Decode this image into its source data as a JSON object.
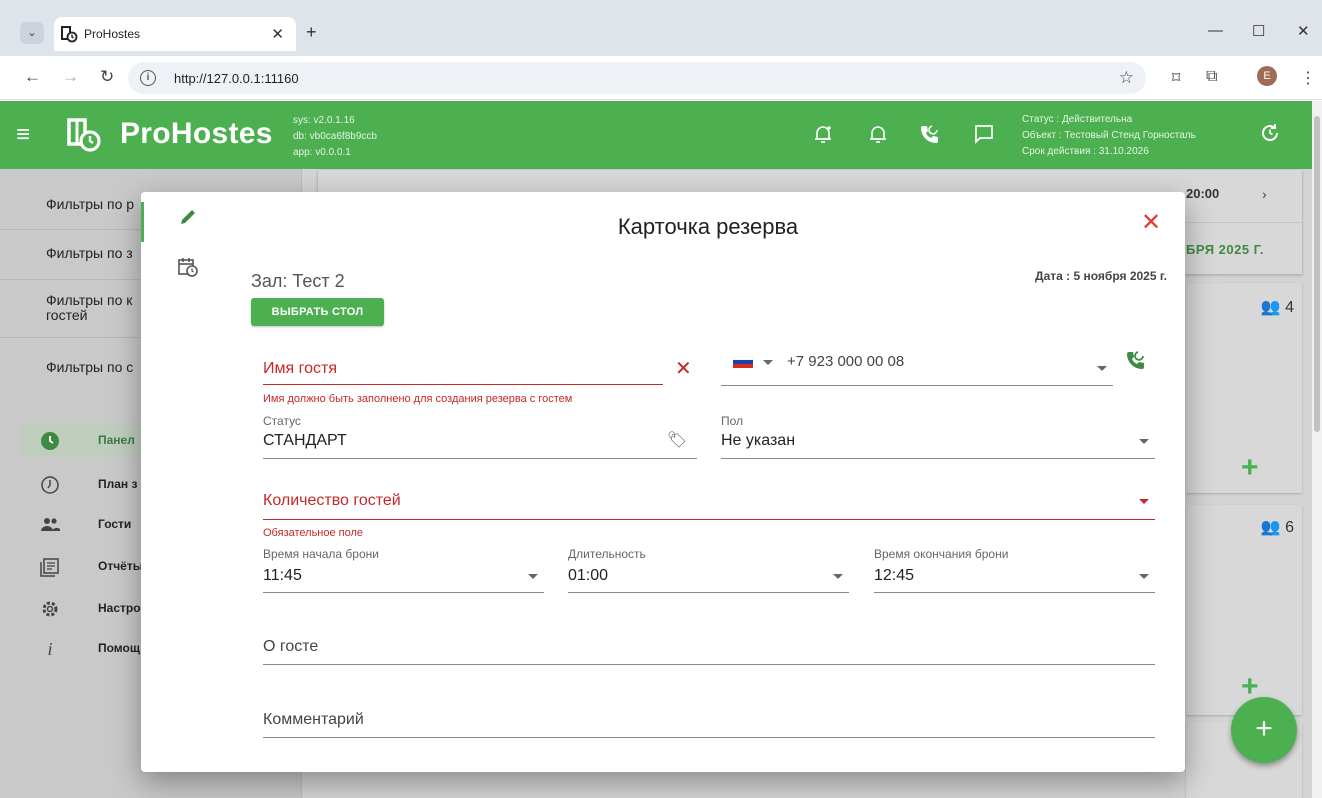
{
  "browser": {
    "tab_title": "ProHostes",
    "tab_close": "✕",
    "new_tab": "+",
    "url": "http://127.0.0.1:11160",
    "profile_initial": "E",
    "window_controls": {
      "minimize": "—",
      "maximize": "☐",
      "close": "✕"
    }
  },
  "app": {
    "name": "ProHostes",
    "versions": [
      "sys: v2.0.1.16",
      "db: vb0ca6f8b9ccb",
      "app: v0.0.0.1"
    ],
    "status_lines": [
      "Статус : Действительна",
      "Объект : Тестовый Стенд Горносталь",
      "Срок действия : 31.10.2026"
    ],
    "accent": "#4caf50",
    "error_color": "#c62828"
  },
  "sidebar": {
    "filters": [
      "Фильтры по р",
      "Фильтры по з",
      "Фильтры по к гостей",
      "Фильтры по с"
    ],
    "filter_lines_3": [
      "Фильтры по к",
      "гостей"
    ],
    "nav": [
      {
        "label": "Панел",
        "icon": "clock-filled-icon",
        "active": true
      },
      {
        "label": "План з",
        "icon": "clock-outline-icon"
      },
      {
        "label": "Гости",
        "icon": "people-icon"
      },
      {
        "label": "Отчёты",
        "icon": "report-icon"
      },
      {
        "label": "Настро",
        "icon": "gear-icon"
      },
      {
        "label": "Помощ",
        "icon": "info-icon"
      }
    ]
  },
  "background": {
    "timeline_time": "20:00",
    "timeline_date": "БРЯ 2025 Г.",
    "guest_counts": [
      "4",
      "6"
    ]
  },
  "modal": {
    "title": "Карточка резерва",
    "hall": "Зал: Тест 2",
    "date": "Дата : 5 ноября 2025 г.",
    "pick_table_button": "ВЫБРАТЬ СТОЛ",
    "guest_name": {
      "placeholder": "Имя гостя",
      "error": "Имя должно быть заполнено для создания резерва с гостем"
    },
    "phone": {
      "value": "+7 923 000 00 08"
    },
    "status": {
      "label": "Статус",
      "value": "СТАНДАРТ"
    },
    "gender": {
      "label": "Пол",
      "value": "Не указан"
    },
    "guests_count": {
      "placeholder": "Количество гостей",
      "error": "Обязательное поле"
    },
    "start_time": {
      "label": "Время начала брони",
      "value": "11:45"
    },
    "duration": {
      "label": "Длительность",
      "value": "01:00"
    },
    "end_time": {
      "label": "Время окончания брони",
      "value": "12:45"
    },
    "about_guest": {
      "placeholder": "О госте"
    },
    "comment": {
      "placeholder": "Комментарий"
    }
  }
}
